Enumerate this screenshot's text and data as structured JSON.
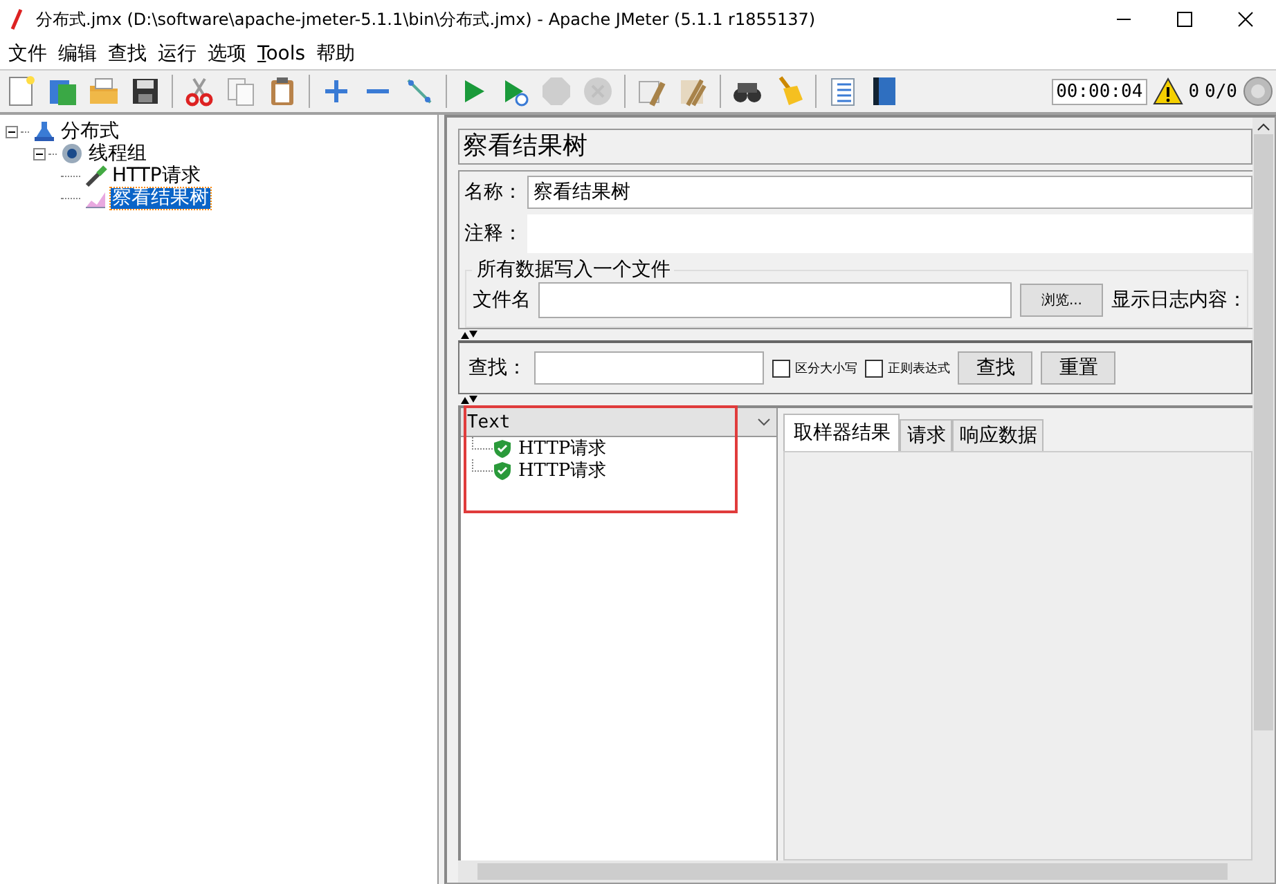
{
  "window": {
    "title": "分布式.jmx (D:\\software\\apache-jmeter-5.1.1\\bin\\分布式.jmx) - Apache JMeter (5.1.1 r1855137)"
  },
  "menu": [
    {
      "label": "文件",
      "mnemonic": false
    },
    {
      "label": "编辑",
      "mnemonic": false
    },
    {
      "label": "查找",
      "mnemonic": false
    },
    {
      "label": "运行",
      "mnemonic": false
    },
    {
      "label": "选项",
      "mnemonic": false
    },
    {
      "label": "Tools",
      "mnemonic": true
    },
    {
      "label": "帮助",
      "mnemonic": false
    }
  ],
  "toolbar": [
    {
      "kind": "new",
      "disabled": false
    },
    {
      "kind": "templates",
      "disabled": false
    },
    {
      "kind": "open",
      "disabled": false
    },
    {
      "kind": "save",
      "disabled": false
    },
    {
      "kind": "sep"
    },
    {
      "kind": "cut",
      "disabled": false
    },
    {
      "kind": "copy",
      "disabled": false
    },
    {
      "kind": "paste",
      "disabled": false
    },
    {
      "kind": "sep"
    },
    {
      "kind": "expand",
      "disabled": false
    },
    {
      "kind": "collapse",
      "disabled": false
    },
    {
      "kind": "toggle",
      "disabled": false
    },
    {
      "kind": "sep"
    },
    {
      "kind": "start",
      "disabled": false
    },
    {
      "kind": "start-no-pause",
      "disabled": false
    },
    {
      "kind": "stop",
      "disabled": true
    },
    {
      "kind": "shutdown",
      "disabled": true
    },
    {
      "kind": "sep"
    },
    {
      "kind": "clear",
      "disabled": false
    },
    {
      "kind": "clear-all",
      "disabled": false
    },
    {
      "kind": "sep"
    },
    {
      "kind": "search",
      "disabled": false
    },
    {
      "kind": "reset-search",
      "disabled": false
    },
    {
      "kind": "sep"
    },
    {
      "kind": "functions",
      "disabled": false
    },
    {
      "kind": "help",
      "disabled": false
    }
  ],
  "status": {
    "timer": "00:00:04",
    "warnings": "0",
    "threads": "0/0"
  },
  "tree": [
    {
      "label": "分布式",
      "kind": "plan",
      "selected": false,
      "expanded": true,
      "children": [
        {
          "label": "线程组",
          "kind": "threads",
          "selected": false,
          "expanded": true,
          "children": [
            {
              "label": "HTTP请求",
              "kind": "sampler",
              "selected": false
            },
            {
              "label": "察看结果树",
              "kind": "listener",
              "selected": true
            }
          ]
        }
      ]
    }
  ],
  "panel": {
    "title": "察看结果树",
    "name_label": "名称：",
    "name_value": "察看结果树",
    "comment_label": "注释：",
    "file_group": "所有数据写入一个文件",
    "file_label": "文件名",
    "browse_button": "浏览...",
    "log_label": "显示日志内容：",
    "search_label": "查找：",
    "case_sensitive": {
      "label": "区分大小写",
      "checked": false
    },
    "regex": {
      "label": "正则表达式",
      "checked": false
    },
    "search_button": "查找",
    "reset_button": "重置"
  },
  "results": {
    "renderer": "Text",
    "items": [
      {
        "label": "HTTP请求",
        "success": true
      },
      {
        "label": "HTTP请求",
        "success": true
      }
    ],
    "annotations": [
      {
        "kind": "rectangle"
      }
    ]
  },
  "tabs": [
    {
      "label": "取样器结果",
      "selected": true
    },
    {
      "label": "请求",
      "selected": false
    },
    {
      "label": "响应数据",
      "selected": false
    }
  ]
}
